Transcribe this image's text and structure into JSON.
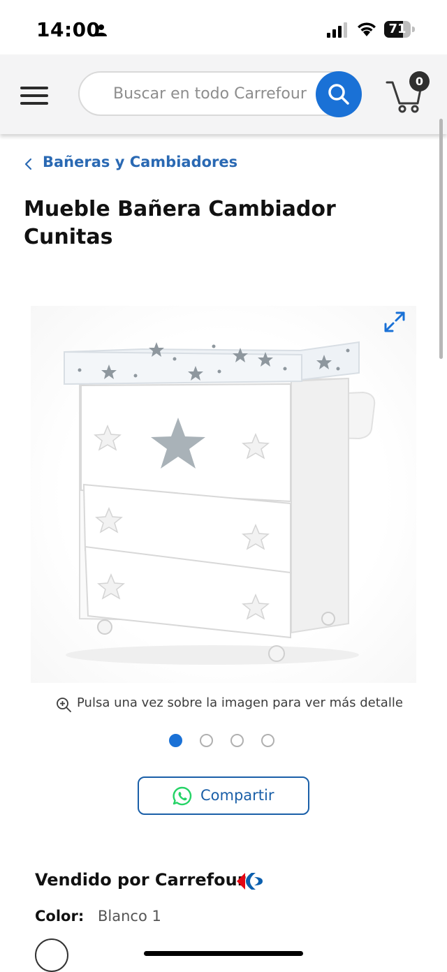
{
  "status_bar": {
    "time": "14:00",
    "battery_level": "71",
    "battery_fraction": 0.71
  },
  "header": {
    "search_placeholder": "Buscar en todo Carrefour",
    "cart_count": "0"
  },
  "breadcrumb": {
    "label": "Bañeras y Cambiadores"
  },
  "product": {
    "title": " Mueble Bañera Cambiador Cunitas",
    "image_alt": "Mueble bañera cambiador blanco con estrellas grises",
    "zoom_hint": "Pulsa una vez sobre la imagen para ver más detalle",
    "carousel": {
      "total_images": 4,
      "active_index": 0
    },
    "share_label": "Compartir",
    "sold_by": "Vendido por Carrefour",
    "color_label": "Color:",
    "color_value": "Blanco 1"
  },
  "colors": {
    "accent_blue": "#1a71d6",
    "link_blue": "#2a69b3",
    "whatsapp_green": "#25d366",
    "carrefour_red": "#e30613",
    "carrefour_blue": "#0b5fae"
  },
  "icons": {
    "menu": "hamburger-menu-icon",
    "search": "search-icon",
    "cart": "cart-icon",
    "breadcrumb": "chevron-left-icon",
    "expand": "expand-icon",
    "zoom": "zoom-in-icon",
    "share": "whatsapp-icon"
  }
}
